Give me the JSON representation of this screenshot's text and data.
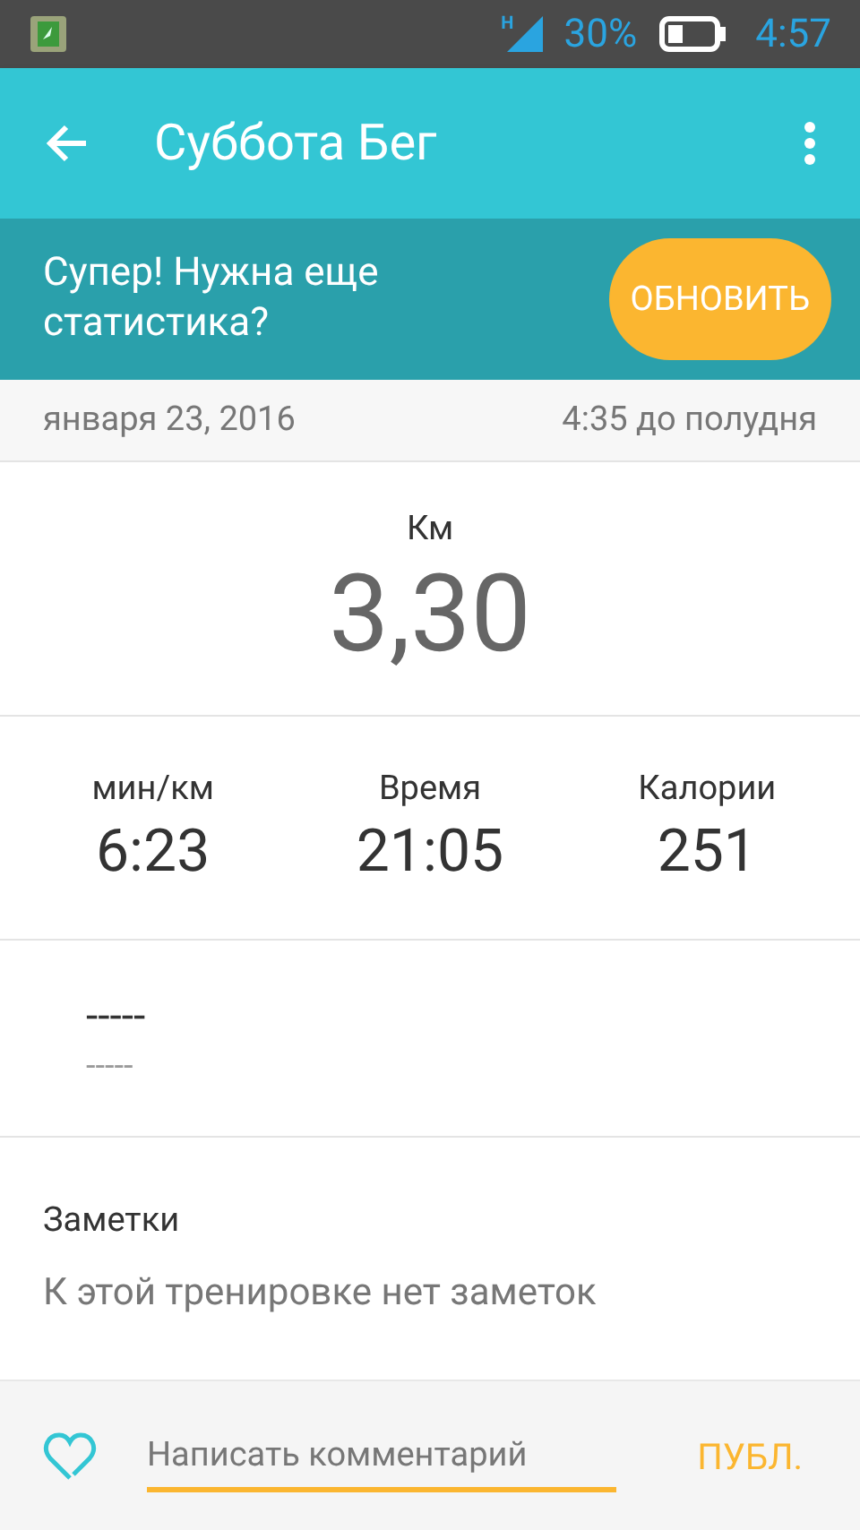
{
  "status_bar": {
    "network": "H",
    "battery": "30%",
    "time": "4:57"
  },
  "toolbar": {
    "title": "Суббота Бег"
  },
  "banner": {
    "text": "Супер! Нужна еще статистика?",
    "button": "ОБНОВИТЬ"
  },
  "date_row": {
    "date": "января 23, 2016",
    "time": "4:35 до полудня"
  },
  "distance": {
    "label": "Км",
    "value": "3,30"
  },
  "stats": [
    {
      "label": "мин/км",
      "value": "6:23"
    },
    {
      "label": "Время",
      "value": "21:05"
    },
    {
      "label": "Калории",
      "value": "251"
    }
  ],
  "extra": {
    "primary": "-----",
    "secondary": "-----"
  },
  "notes": {
    "title": "Заметки",
    "text": "К этой тренировке нет заметок"
  },
  "comment_bar": {
    "placeholder": "Написать комментарий",
    "button": "ПУБЛ."
  }
}
